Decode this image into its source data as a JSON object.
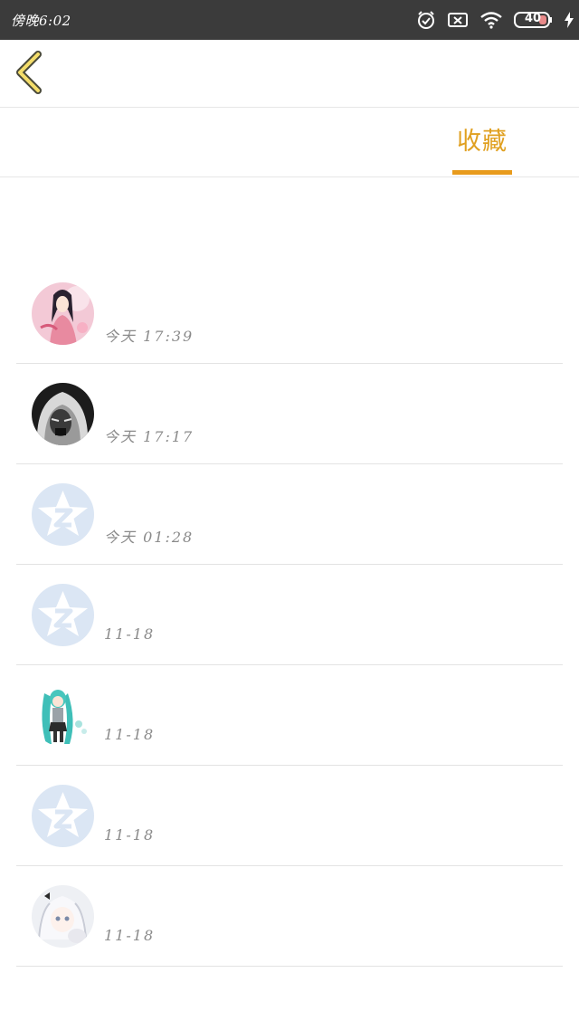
{
  "status_bar": {
    "time": "傍晚6:02",
    "battery": "40"
  },
  "tabs": {
    "favorites_label": "收藏"
  },
  "colors": {
    "accent": "#e89b1c",
    "status_bar_bg": "#3b3b3b",
    "default_avatar": "#dbe6f4"
  },
  "items": [
    {
      "time": "今天 17:39",
      "avatar": "anime-girl-pink"
    },
    {
      "time": "今天 17:17",
      "avatar": "hooded-figure-bw"
    },
    {
      "time": "今天 01:28",
      "avatar": "default-qzone-star"
    },
    {
      "time": "11-18",
      "avatar": "default-qzone-star"
    },
    {
      "time": "11-18",
      "avatar": "miku-figure"
    },
    {
      "time": "11-18",
      "avatar": "default-qzone-star"
    },
    {
      "time": "11-18",
      "avatar": "anime-girl-white"
    }
  ]
}
